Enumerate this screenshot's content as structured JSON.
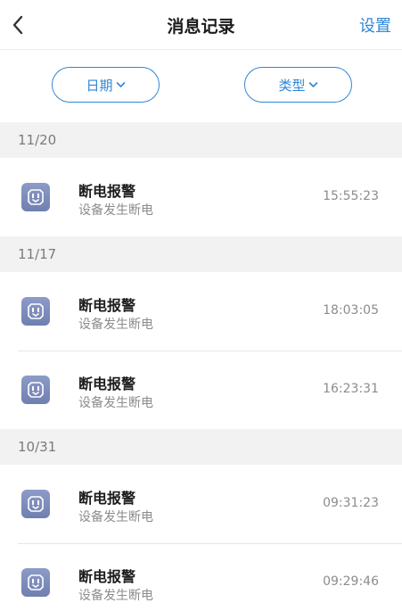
{
  "header": {
    "title": "消息记录",
    "settings_label": "设置"
  },
  "filters": {
    "date_label": "日期",
    "type_label": "类型"
  },
  "colors": {
    "accent": "#2f86d6",
    "section_bg": "#f2f2f2",
    "icon_bg": "#7d8cbd"
  },
  "groups": [
    {
      "date": "11/20",
      "items": [
        {
          "title": "断电报警",
          "subtitle": "设备发生断电",
          "time": "15:55:23",
          "icon": "power-outlet-icon"
        }
      ]
    },
    {
      "date": "11/17",
      "items": [
        {
          "title": "断电报警",
          "subtitle": "设备发生断电",
          "time": "18:03:05",
          "icon": "power-outlet-icon"
        },
        {
          "title": "断电报警",
          "subtitle": "设备发生断电",
          "time": "16:23:31",
          "icon": "power-outlet-icon"
        }
      ]
    },
    {
      "date": "10/31",
      "items": [
        {
          "title": "断电报警",
          "subtitle": "设备发生断电",
          "time": "09:31:23",
          "icon": "power-outlet-icon"
        },
        {
          "title": "断电报警",
          "subtitle": "设备发生断电",
          "time": "09:29:46",
          "icon": "power-outlet-icon"
        }
      ]
    }
  ]
}
